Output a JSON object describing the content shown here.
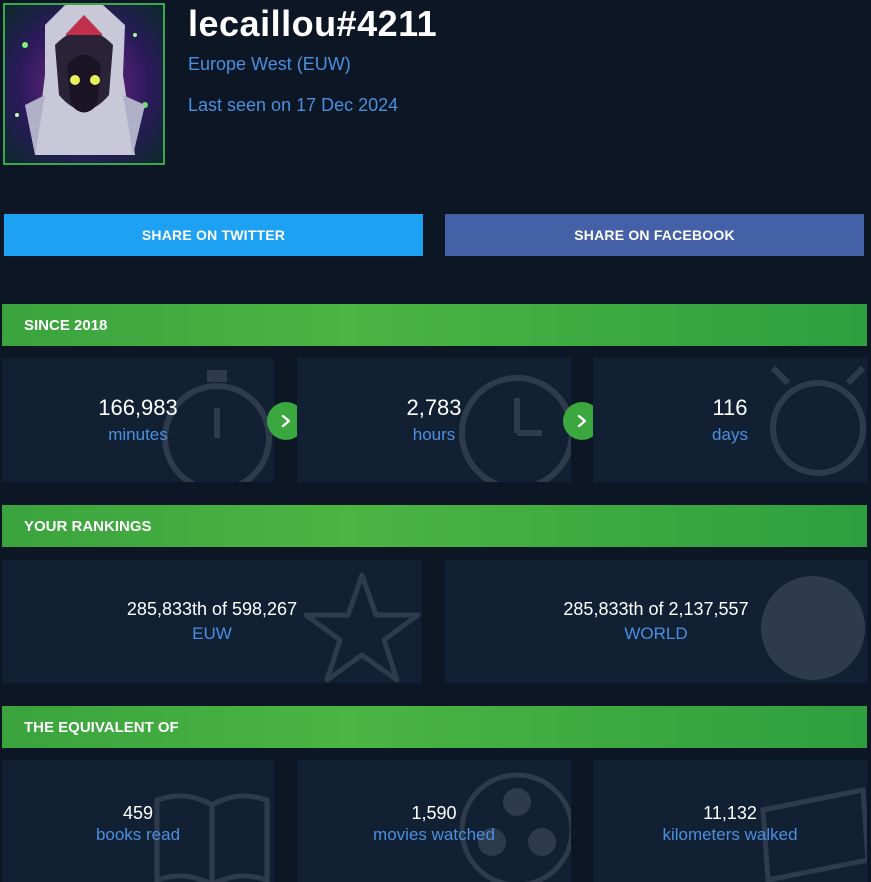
{
  "profile": {
    "name": "lecaillou#4211",
    "region": "Europe West (EUW)",
    "last_seen": "Last seen on 17 Dec 2024"
  },
  "share": {
    "twitter_label": "SHARE ON TWITTER",
    "facebook_label": "SHARE ON FACEBOOK",
    "twitter_color": "#1da1f2",
    "facebook_color": "#4460a6"
  },
  "since": {
    "title": "SINCE 2018",
    "minutes": {
      "value": "166,983",
      "unit": "minutes"
    },
    "hours": {
      "value": "2,783",
      "unit": "hours"
    },
    "days": {
      "value": "116",
      "unit": "days"
    }
  },
  "rankings": {
    "title": "YOUR RANKINGS",
    "region": {
      "value": "285,833th of 598,267",
      "label": "EUW"
    },
    "world": {
      "value": "285,833th of 2,137,557",
      "label": "WORLD"
    }
  },
  "equivalent": {
    "title": "THE EQUIVALENT OF",
    "books": {
      "value": "459",
      "label": "books read"
    },
    "movies": {
      "value": "1,590",
      "label": "movies watched"
    },
    "km": {
      "value": "11,132",
      "label": "kilometers walked"
    }
  },
  "colors": {
    "background": "#0c1624",
    "card": "#112033",
    "accent_green": "#3aa83e",
    "link_blue": "#4b8fe0"
  },
  "icons": [
    "champion-avatar",
    "stopwatch-icon",
    "clock-icon",
    "sun-icon",
    "star-icon",
    "globe-icon",
    "book-icon",
    "film-reel-icon",
    "ticket-icon",
    "chevron-right-icon"
  ]
}
